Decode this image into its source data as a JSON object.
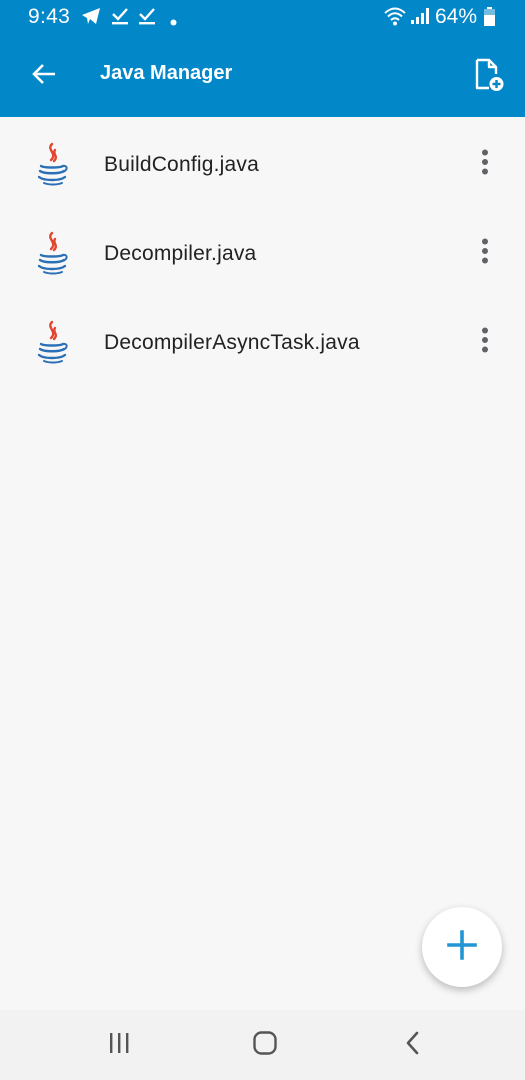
{
  "status_bar": {
    "time": "9:43",
    "battery": "64%",
    "icons": [
      "telegram-icon",
      "download-done-icon",
      "download-done-icon",
      "dot-icon",
      "wifi-icon",
      "signal-icon",
      "battery-icon"
    ]
  },
  "app_bar": {
    "title": "Java Manager",
    "back_icon": "arrow-back-icon",
    "action_icon": "new-file-icon",
    "color": "#0287c9"
  },
  "files": [
    {
      "name": "BuildConfig.java",
      "icon": "java-icon"
    },
    {
      "name": "Decompiler.java",
      "icon": "java-icon"
    },
    {
      "name": "DecompilerAsyncTask.java",
      "icon": "java-icon"
    }
  ],
  "fab": {
    "icon": "plus-icon",
    "color": "#2196d3"
  },
  "nav_bar": {
    "buttons": [
      "recent-apps-icon",
      "home-icon",
      "back-icon"
    ]
  }
}
